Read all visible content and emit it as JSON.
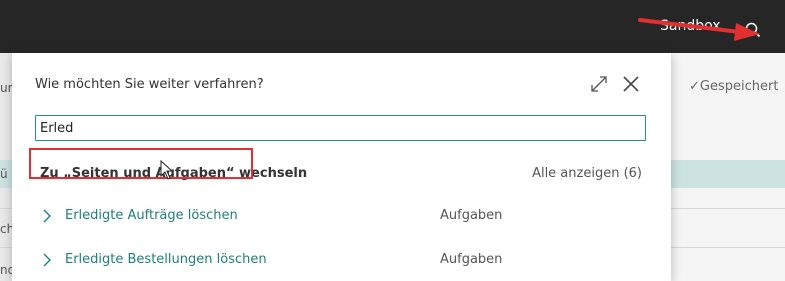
{
  "topbar": {
    "environment_label": "Sandbox",
    "search_icon": "search-icon"
  },
  "background": {
    "saved_label": "Gespeichert",
    "fragments": [
      "um",
      "ü",
      "ch",
      "nd"
    ]
  },
  "dialog": {
    "title": "Wie möchten Sie weiter verfahren?",
    "expand_icon": "expand-icon",
    "close_icon": "close-icon",
    "search_value": "Erled",
    "section_title": "Zu „Seiten und Aufgaben“ wechseln",
    "show_all_label": "Alle anzeigen (6)",
    "results": [
      {
        "label": "Erledigte Aufträge löschen",
        "category": "Aufgaben"
      },
      {
        "label": "Erledigte Bestellungen löschen",
        "category": "Aufgaben"
      }
    ]
  },
  "colors": {
    "topbar": "#262626",
    "accent": "#1f7f7a",
    "annotation": "#e03030"
  }
}
